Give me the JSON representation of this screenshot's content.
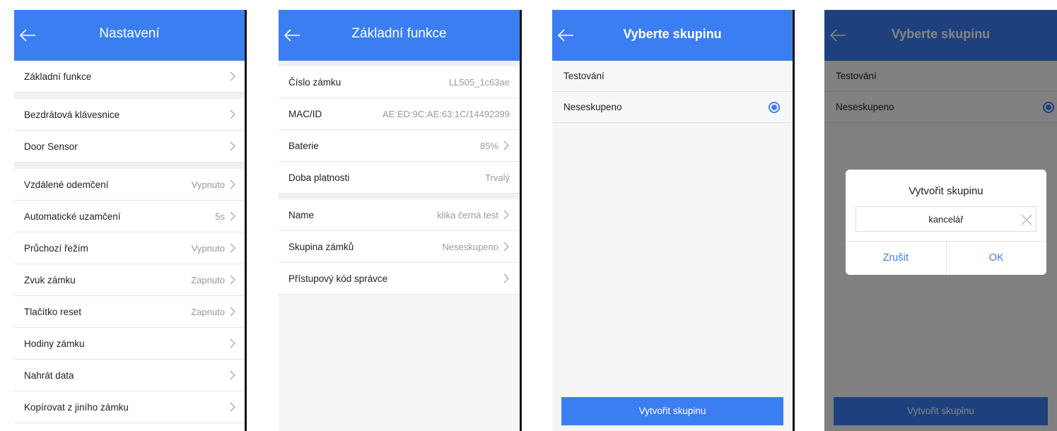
{
  "colors": {
    "accent": "#3b7ef2",
    "divider": "#111111"
  },
  "screen1": {
    "title": "Nastavení",
    "rows": [
      {
        "label": "Základní funkce",
        "value": ""
      },
      {
        "label": "Bezdrátová klávesnice",
        "value": ""
      },
      {
        "label": "Door Sensor",
        "value": ""
      },
      {
        "label": "Vzdálené odemčení",
        "value": "Vypnuto"
      },
      {
        "label": "Automatické uzamčení",
        "value": "5s"
      },
      {
        "label": "Průchozí řežím",
        "value": "Vypnuto"
      },
      {
        "label": "Zvuk zámku",
        "value": "Zapnuto"
      },
      {
        "label": "Tlačítko reset",
        "value": "Zapnuto"
      },
      {
        "label": "Hodiny zámku",
        "value": ""
      },
      {
        "label": "Nahrát data",
        "value": ""
      },
      {
        "label": "Kopírovat z jiního zámku",
        "value": ""
      }
    ]
  },
  "screen2": {
    "title": "Základní funkce",
    "rows": [
      {
        "label": "Číslo zámku",
        "value": "LL505_1c63ae"
      },
      {
        "label": "MAC/ID",
        "value": "AE:ED:9C:AE:63:1C/14492399"
      },
      {
        "label": "Baterie",
        "value": "85%"
      },
      {
        "label": "Doba platnosti",
        "value": "Trvalý"
      },
      {
        "label": "Name",
        "value": "klika černá test"
      },
      {
        "label": "Skupina zámků",
        "value": "Neseskupeno"
      },
      {
        "label": "Přístupový kód správce",
        "value": ""
      }
    ]
  },
  "screen3": {
    "title": "Vyberte skupinu",
    "groups": [
      {
        "label": "Testování",
        "selected": false
      },
      {
        "label": "Neseskupeno",
        "selected": true
      }
    ],
    "create_button": "Vytvořit skupinu"
  },
  "screen4": {
    "title": "Vyberte skupinu",
    "groups": [
      {
        "label": "Testování",
        "selected": false
      },
      {
        "label": "Neseskupeno",
        "selected": true
      }
    ],
    "create_button": "Vytvořit skupinu",
    "dialog": {
      "title": "Vytvořit skupinu",
      "input_value": "kancelář",
      "cancel_label": "Zrušit",
      "ok_label": "OK"
    }
  }
}
